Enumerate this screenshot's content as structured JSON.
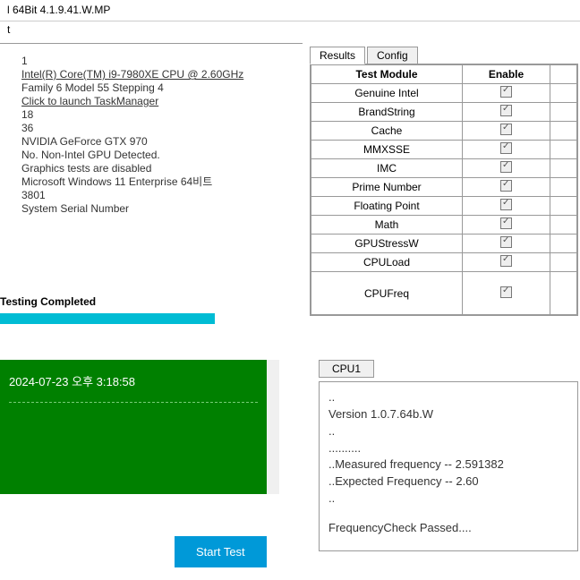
{
  "window": {
    "title": "l 64Bit 4.1.9.41.W.MP"
  },
  "menu": {
    "item": "t"
  },
  "info": {
    "l1": "1",
    "cpu_link": "Intel(R) Core(TM) i9-7980XE CPU @ 2.60GHz",
    "family": "Family 6 Model 55 Stepping 4",
    "taskmgr": "Click to launch TaskManager",
    "n18": "18",
    "n36": "36",
    "gpu": "NVIDIA GeForce GTX 970",
    "nointel": "No. Non-Intel GPU Detected.",
    "gfx": "Graphics tests are disabled",
    "os": "Microsoft Windows 11 Enterprise 64비트",
    "bios": "3801",
    "serial": "System Serial Number"
  },
  "status": {
    "label": "Testing Completed"
  },
  "tabs": {
    "results": "Results",
    "config": "Config"
  },
  "grid": {
    "header_module": "Test Module",
    "header_enable": "Enable",
    "rows": [
      {
        "name": "Genuine Intel"
      },
      {
        "name": "BrandString"
      },
      {
        "name": "Cache"
      },
      {
        "name": "MMXSSE"
      },
      {
        "name": "IMC"
      },
      {
        "name": "Prime Number"
      },
      {
        "name": "Floating Point"
      },
      {
        "name": "Math"
      },
      {
        "name": "GPUStressW"
      },
      {
        "name": "CPULoad"
      },
      {
        "name": "CPUFreq"
      }
    ]
  },
  "green": {
    "ts": "2024-07-23 오후 3:18:58"
  },
  "start": {
    "label": "Start Test"
  },
  "cpu": {
    "tab": "CPU1",
    "line1": "..",
    "line2": "Version 1.0.7.64b.W",
    "line3": "..",
    "line4": "..........",
    "line5": "..Measured frequency -- 2.591382",
    "line6": "..Expected Frequency -- 2.60",
    "line7": "..",
    "line8": "FrequencyCheck Passed...."
  }
}
